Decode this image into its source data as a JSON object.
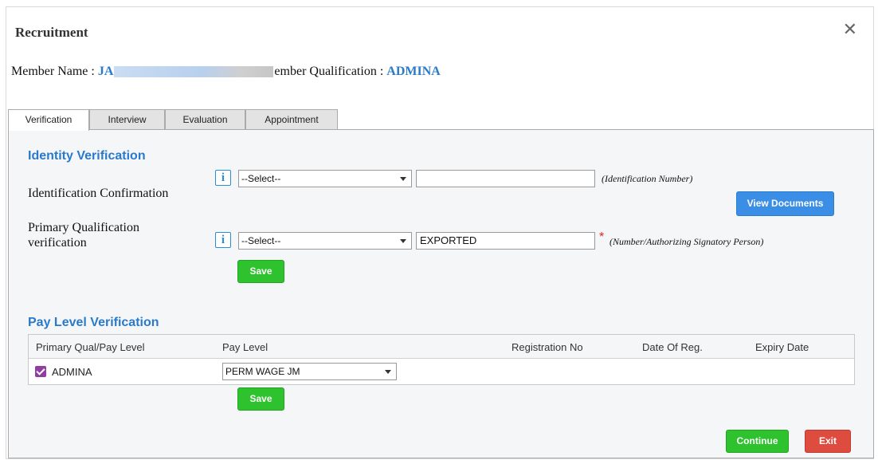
{
  "dialog": {
    "title": "Recruitment",
    "close_icon": "close-icon"
  },
  "member": {
    "name_label": "Member Name :",
    "name_value_visible": "JA",
    "qualification_label_partial": "ember Qualification :",
    "qualification_value": "ADMINA"
  },
  "tabs": [
    {
      "label": "Verification",
      "active": true
    },
    {
      "label": "Interview",
      "active": false
    },
    {
      "label": "Evaluation",
      "active": false
    },
    {
      "label": "Appointment",
      "active": false
    }
  ],
  "identity": {
    "section_title": "Identity Verification",
    "row1": {
      "label": "Identification Confirmation",
      "select_value": "--Select--",
      "input_value": "",
      "hint": "(Identification Number)"
    },
    "row2": {
      "label": "Primary Qualification verification",
      "select_value": "--Select--",
      "input_value": "EXPORTED",
      "required_mark": "*",
      "hint": "(Number/Authorizing Signatory Person)"
    },
    "view_documents_label": "View Documents",
    "save_label": "Save",
    "info_glyph": "i"
  },
  "pay_level": {
    "section_title": "Pay Level Verification",
    "columns": [
      "Primary Qual/Pay Level",
      "Pay Level",
      "Registration No",
      "Date Of Reg.",
      "Expiry Date"
    ],
    "rows": [
      {
        "checked": true,
        "qualification": "ADMINA",
        "pay_level": "PERM WAGE JM",
        "registration_no": "",
        "date_of_reg": "",
        "expiry_date": ""
      }
    ],
    "save_label": "Save"
  },
  "footer": {
    "continue_label": "Continue",
    "exit_label": "Exit"
  },
  "colors": {
    "accent_blue": "#2a7ac9",
    "save_green": "#2ec22e",
    "exit_red": "#de4b3f",
    "checkbox_purple": "#8e3fa0"
  }
}
